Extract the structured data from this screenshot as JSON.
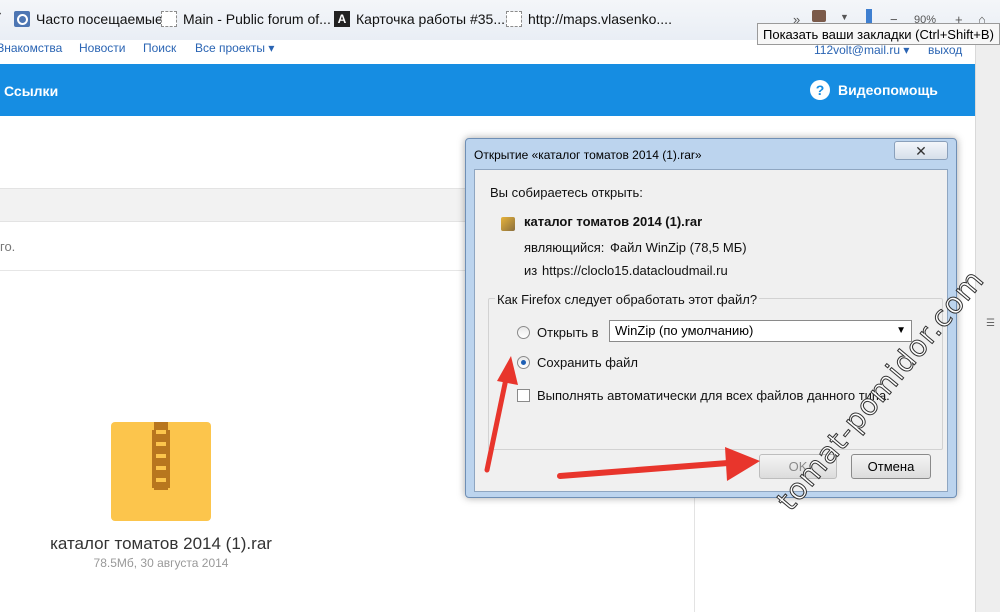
{
  "bookmarks": [
    {
      "label": "Часто посещаемые"
    },
    {
      "label": "Main - Public forum of..."
    },
    {
      "label": "Карточка работы #35..."
    },
    {
      "label": "http://maps.vlasenko...."
    }
  ],
  "toolbar": {
    "zoom": "90%",
    "overflow": "»"
  },
  "tooltip": "Показать ваши закладки (Ctrl+Shift+B)",
  "site_nav": {
    "links": [
      "Знакомства",
      "Новости",
      "Поиск",
      "Все проекты ▾"
    ],
    "account": "112volt@mail.ru ▾",
    "logout": "выход"
  },
  "header": {
    "section": "Ссылки",
    "help": "Видеопомощь",
    "help_icon": "question-circle-icon"
  },
  "page": {
    "info_text": "го."
  },
  "file": {
    "name": "каталог томатов 2014 (1).rar",
    "meta": "78.5Мб, 30 августа 2014"
  },
  "dialog": {
    "title": "Открытие «каталог томатов 2014 (1).rar»",
    "close": "✕",
    "intro": "Вы собираетесь открыть:",
    "filename": "каталог томатов 2014 (1).rar",
    "type_label": "являющийся:",
    "type_value": "Файл WinZip (78,5 МБ)",
    "from_label": "из",
    "from_value": "https://cloclo15.datacloudmail.ru",
    "question": "Как Firefox следует обработать этот файл?",
    "open_with_label": "Открыть в",
    "open_with_value": "WinZip (по умолчанию)",
    "save_label": "Сохранить файл",
    "save_selected": true,
    "auto_label": "Выполнять автоматически для всех файлов данного типа.",
    "auto_checked": false,
    "ok": "OK",
    "cancel": "Отмена"
  },
  "watermark": "tomat-pomidor.com",
  "colors": {
    "header_blue": "#168de2",
    "archive_yellow": "#fcc54c",
    "arrow_red": "#e8352c",
    "link_blue": "#2a64b3"
  }
}
